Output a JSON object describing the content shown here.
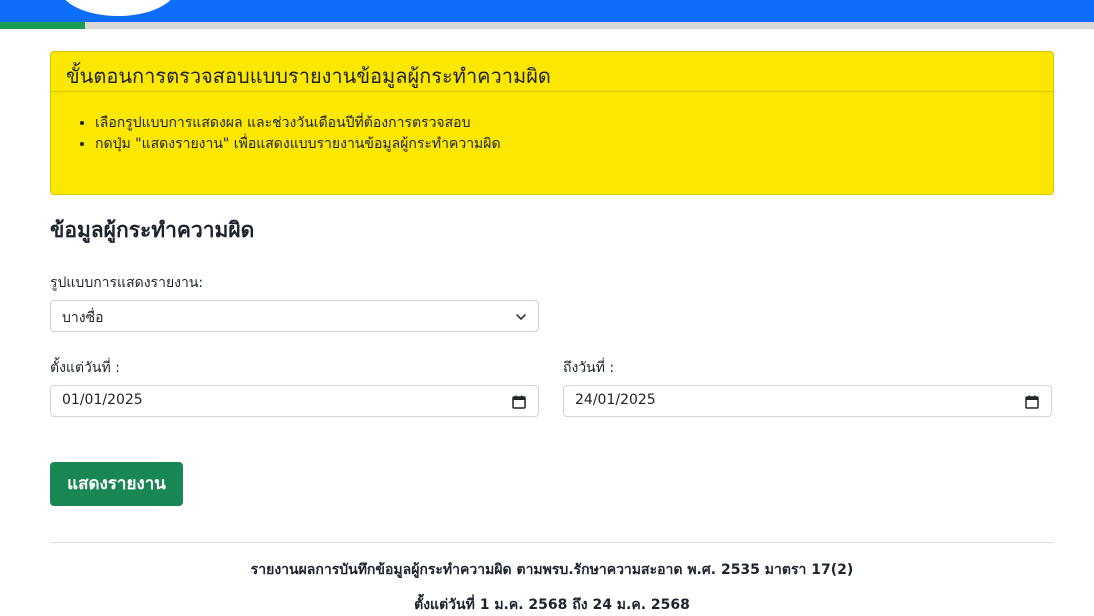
{
  "card": {
    "title": "ขั้นตอนการตรวจสอบแบบรายงานข้อมูลผู้กระทำความผิด",
    "steps": [
      "เลือกรูปแบบการแสดงผล และช่วงวันเดือนปีที่ต้องการตรวจสอบ",
      "กดปุ่ม \"แสดงรายงาน\" เพื่อแสดงแบบรายงานข้อมูลผู้กระทำความผิด"
    ]
  },
  "form": {
    "section_title": "ข้อมูลผู้กระทำความผิด",
    "format_label": "รูปแบบการแสดงรายงาน:",
    "format_value": "บางซื่อ",
    "from_label": "ตั้งแต่วันที่ :",
    "from_value": "01/01/2025",
    "to_label": "ถึงวันที่ :",
    "to_value": "24/01/2025",
    "submit_label": "แสดงรายงาน"
  },
  "report": {
    "title": "รายงานผลการบันทึกข้อมูลผู้กระทำความผิด ตามพรบ.รักษาความสะอาด พ.ศ. 2535 มาตรา 17(2)",
    "range": "ตั้งแต่วันที่ 1 ม.ค. 2568 ถึง 24 ม.ค. 2568"
  },
  "colors": {
    "topbar": "#0d6efd",
    "card_bg": "#fbe700",
    "button": "#198754"
  }
}
